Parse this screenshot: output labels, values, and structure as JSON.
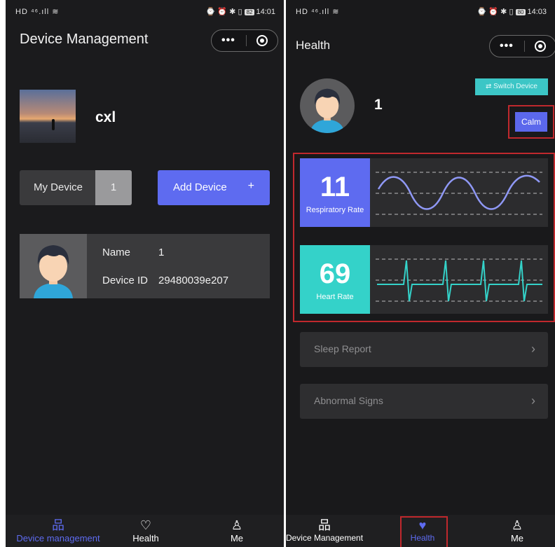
{
  "left_screen": {
    "status": {
      "left": "HD ⁴⁶.ıll ≋",
      "right": "14:01",
      "battery": "82"
    },
    "title": "Device Management",
    "profile": {
      "name": "cxl"
    },
    "my_device": {
      "label": "My Device",
      "count": "1"
    },
    "add_device": {
      "label": "Add Device",
      "plus": "+"
    },
    "device_card": {
      "name_label": "Name",
      "name_value": "1",
      "id_label": "Device ID",
      "id_value": "29480039e207"
    },
    "tabs": [
      {
        "label": "Device management",
        "icon": "sitemap-icon",
        "active": true
      },
      {
        "label": "Health",
        "icon": "heart-pulse-icon",
        "active": false
      },
      {
        "label": "Me",
        "icon": "person-icon",
        "active": false
      }
    ]
  },
  "right_screen": {
    "status": {
      "left": "HD ⁴⁶.ıll ≋",
      "right": "14:03",
      "battery": "80"
    },
    "title": "Health",
    "device_number": "1",
    "switch_device": "Switch Device",
    "mood": "Calm",
    "respiratory": {
      "value": "11",
      "label": "Respiratory Rate",
      "color": "#5e6bf0"
    },
    "heart": {
      "value": "69",
      "label": "Heart Rate",
      "color": "#34d2c9"
    },
    "sleep_report": "Sleep Report",
    "abnormal_signs": "Abnormal Signs",
    "tabs": [
      {
        "label": "Device Management",
        "icon": "sitemap-icon",
        "active": false
      },
      {
        "label": "Health",
        "icon": "heart-pulse-icon",
        "active": true
      },
      {
        "label": "Me",
        "icon": "person-icon",
        "active": false
      }
    ]
  }
}
